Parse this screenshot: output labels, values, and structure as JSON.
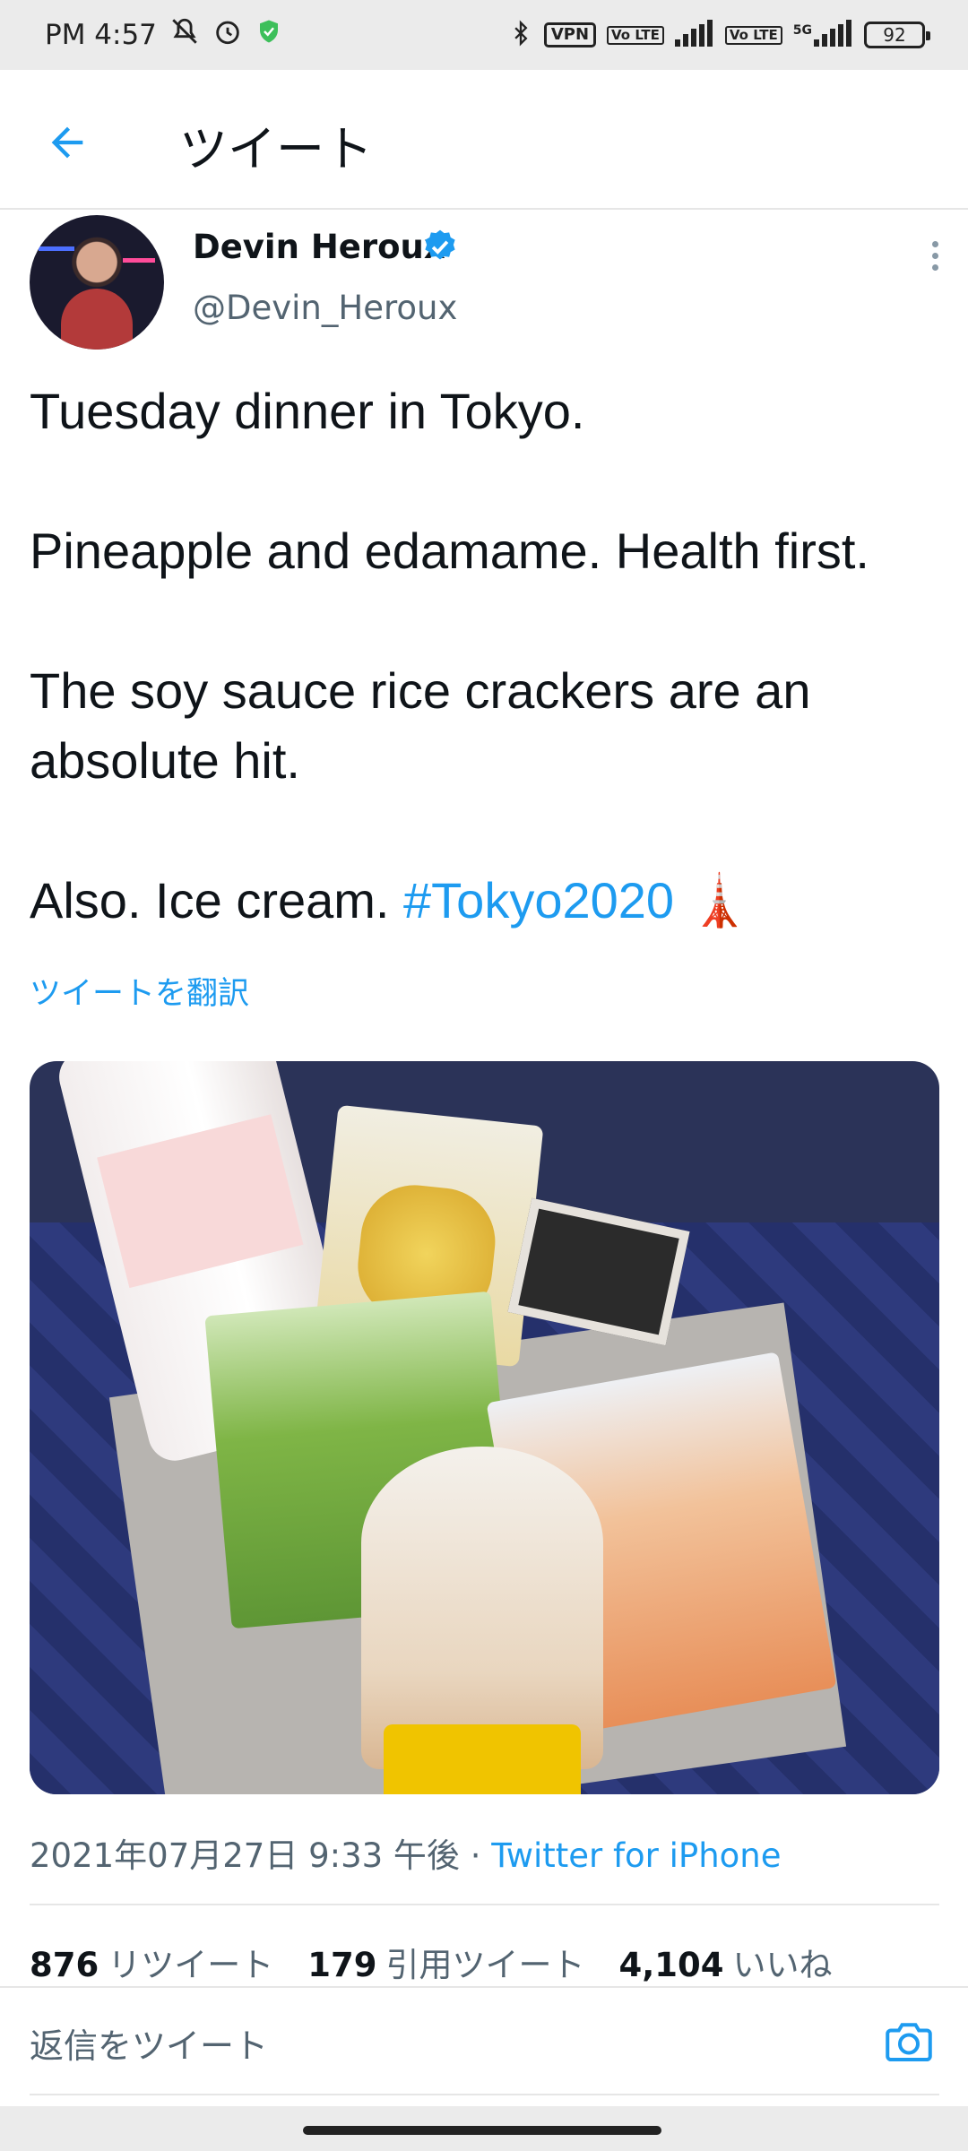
{
  "status_bar": {
    "time": "PM 4:57",
    "vpn": "VPN",
    "volte1": "Vo LTE",
    "volte2": "Vo LTE",
    "network": "5G",
    "battery": "92"
  },
  "header": {
    "title": "ツイート"
  },
  "tweet": {
    "author_name": "Devin Heroux",
    "handle": "@Devin_Heroux",
    "line1": "Tuesday dinner in Tokyo.",
    "line2": "Pineapple and edamame. Health first.",
    "line3": "The soy sauce rice crackers are an absolute hit.",
    "line4": "Also. Ice cream. ",
    "hashtag": "#Tokyo2020",
    "emoji": "🗼",
    "translate_label": "ツイートを翻訳",
    "timestamp": "2021年07月27日 9:33 午後 · ",
    "source": "Twitter for iPhone"
  },
  "stats": {
    "retweets_count": "876",
    "retweets_label": "リツイート",
    "quotes_count": "179",
    "quotes_label": "引用ツイート",
    "likes_count": "4,104",
    "likes_label": "いいね"
  },
  "reply": {
    "placeholder": "返信をツイート"
  },
  "colors": {
    "accent": "#1d9bf0",
    "secondary_text": "#536471"
  }
}
